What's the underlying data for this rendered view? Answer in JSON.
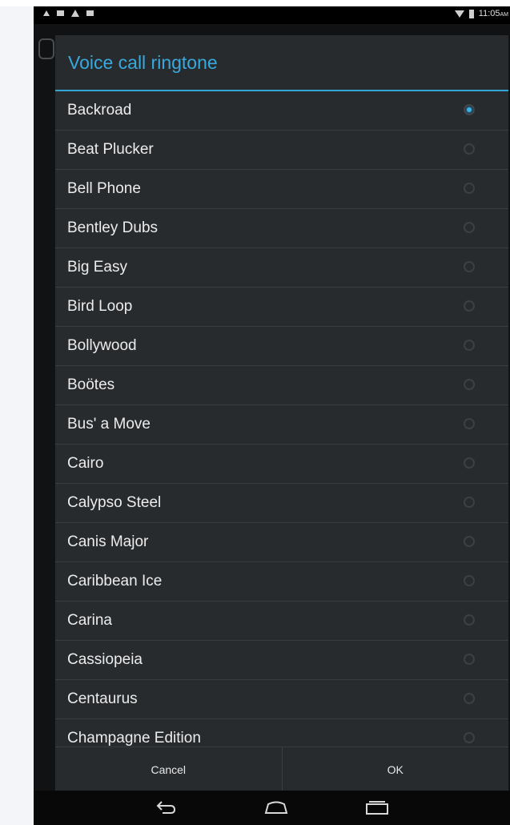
{
  "status_bar": {
    "time": "11:05",
    "time_suffix": "AM"
  },
  "dialog": {
    "title": "Voice call ringtone",
    "items": [
      {
        "label": "Backroad",
        "selected": true
      },
      {
        "label": "Beat Plucker",
        "selected": false
      },
      {
        "label": "Bell Phone",
        "selected": false
      },
      {
        "label": "Bentley Dubs",
        "selected": false
      },
      {
        "label": "Big Easy",
        "selected": false
      },
      {
        "label": "Bird Loop",
        "selected": false
      },
      {
        "label": "Bollywood",
        "selected": false
      },
      {
        "label": "Boötes",
        "selected": false
      },
      {
        "label": "Bus' a Move",
        "selected": false
      },
      {
        "label": "Cairo",
        "selected": false
      },
      {
        "label": "Calypso Steel",
        "selected": false
      },
      {
        "label": "Canis Major",
        "selected": false
      },
      {
        "label": "Caribbean Ice",
        "selected": false
      },
      {
        "label": "Carina",
        "selected": false
      },
      {
        "label": "Cassiopeia",
        "selected": false
      },
      {
        "label": "Centaurus",
        "selected": false
      },
      {
        "label": "Champagne Edition",
        "selected": false
      }
    ],
    "cancel_label": "Cancel",
    "ok_label": "OK"
  },
  "nav": {
    "icons": [
      "back-icon",
      "home-icon",
      "recent-apps-icon"
    ]
  },
  "colors": {
    "accent": "#38a9dd",
    "dialog_bg": "#282b2e",
    "radio_selected": "#35b3ea"
  }
}
